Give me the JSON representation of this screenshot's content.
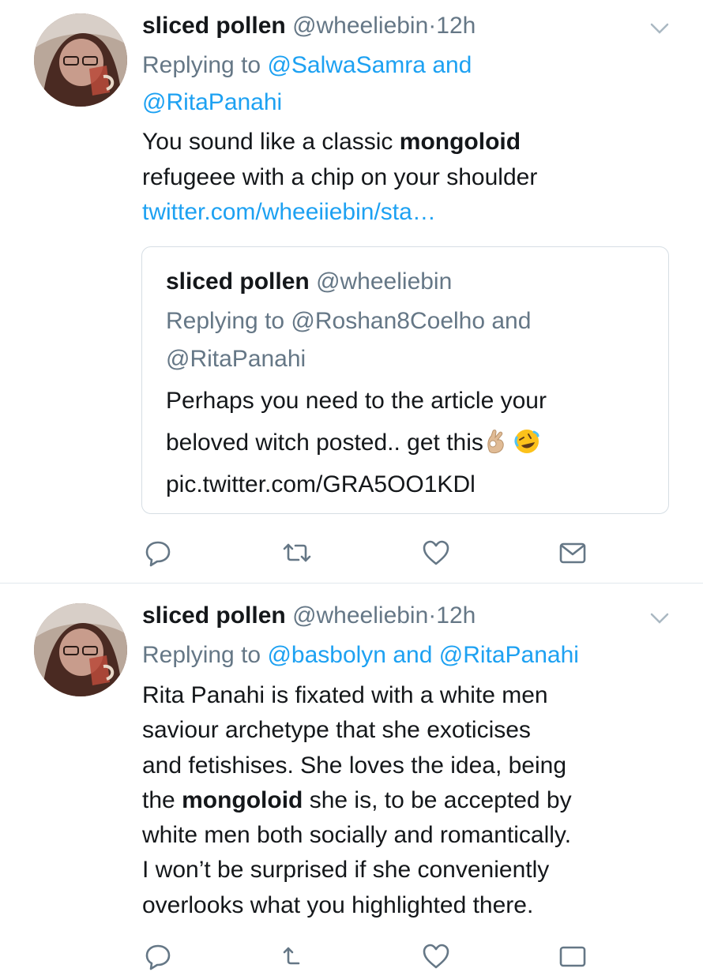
{
  "tweets": [
    {
      "name": "sliced pollen",
      "handle": "@wheeliebin",
      "separator": "·",
      "time": "12h",
      "replying_prefix": "Replying to",
      "reply_mention_1": "@SalwaSamra",
      "reply_and": "and",
      "reply_mention_2": "@RitaPanahi",
      "text_1": "You sound like a classic",
      "text_bold": "mongoloid",
      "text_2": "refugeee with a chip on your shoulder",
      "link": "twitter.com/wheeiiebin/sta…",
      "quote": {
        "name": "sliced pollen",
        "handle": "@wheeliebin",
        "replying": "Replying to @Roshan8Coelho and",
        "replying_2": "@RitaPanahi",
        "text_1": "Perhaps you need to the article your",
        "text_2": "beloved witch posted.. get this",
        "emoji_1": "ok-hand-emoji",
        "emoji_2": "rolling-on-floor-laughing-emoji",
        "pic_link": "pic.twitter.com/GRA5OO1KDl"
      },
      "actions": [
        "reply-icon",
        "retweet-icon",
        "like-icon",
        "direct-message-icon"
      ]
    },
    {
      "name": "sliced pollen",
      "handle": "@wheeliebin",
      "separator": "·",
      "time": "12h",
      "replying_prefix": "Replying to",
      "reply_mention_1": "@basbolyn",
      "reply_and": "and",
      "reply_mention_2": "@RitaPanahi",
      "line_1": "Rita Panahi is fixated with a white men",
      "line_2": "saviour archetype that she exoticises",
      "line_3": "and fetishises. She loves the idea, being",
      "line_4_pre": "the",
      "line_4_bold": "mongoloid",
      "line_4_post": "she is, to be accepted by",
      "line_5": "white men both socially and romantically.",
      "line_6": "I won’t be surprised if she conveniently",
      "line_7": "overlooks what you highlighted there."
    }
  ],
  "colors": {
    "name": "#14171a",
    "secondary": "#657786",
    "link": "#1da1f2",
    "divider": "#e1e8ed",
    "icon": "#657786"
  }
}
